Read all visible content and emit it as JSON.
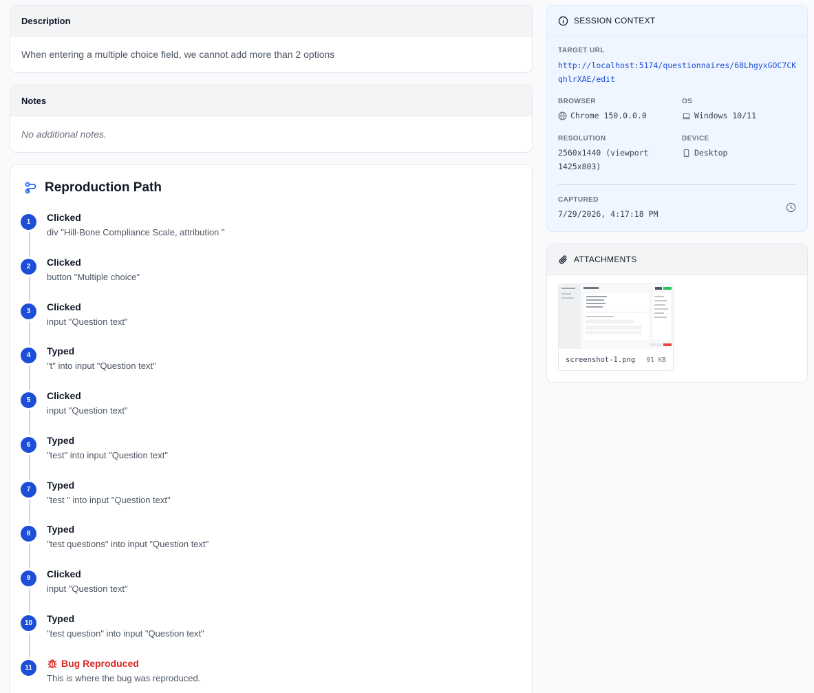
{
  "description": {
    "title": "Description",
    "text": "When entering a multiple choice field, we cannot add more than 2 options"
  },
  "notes": {
    "title": "Notes",
    "text": "No additional notes."
  },
  "repro": {
    "title": "Reproduction Path",
    "steps": [
      {
        "num": "1",
        "action": "Clicked",
        "detail": "div \"Hill-Bone Compliance Scale, attribution \""
      },
      {
        "num": "2",
        "action": "Clicked",
        "detail": "button \"Multiple choice\""
      },
      {
        "num": "3",
        "action": "Clicked",
        "detail": "input \"Question text\""
      },
      {
        "num": "4",
        "action": "Typed",
        "detail": "\"t\" into input \"Question text\""
      },
      {
        "num": "5",
        "action": "Clicked",
        "detail": "input \"Question text\""
      },
      {
        "num": "6",
        "action": "Typed",
        "detail": "\"test\" into input \"Question text\""
      },
      {
        "num": "7",
        "action": "Typed",
        "detail": "\"test \" into input \"Question text\""
      },
      {
        "num": "8",
        "action": "Typed",
        "detail": "\"test questions\" into input \"Question text\""
      },
      {
        "num": "9",
        "action": "Clicked",
        "detail": "input \"Question text\""
      },
      {
        "num": "10",
        "action": "Typed",
        "detail": "\"test question\" into input \"Question text\""
      },
      {
        "num": "11",
        "action": "Bug Reproduced",
        "detail": "This is where the bug was reproduced."
      }
    ]
  },
  "session": {
    "title": "SESSION CONTEXT",
    "target_url_label": "TARGET URL",
    "target_url_line1": "http://localhost:5174/questionnaires/68LhgyxGOC7CK",
    "target_url_line2": "qhlrXAE/edit",
    "browser_label": "BROWSER",
    "browser": "Chrome 150.0.0.0",
    "os_label": "OS",
    "os": "Windows 10/11",
    "resolution_label": "RESOLUTION",
    "resolution_line1": "2560x1440 (viewport",
    "resolution_line2": "1425x803)",
    "device_label": "DEVICE",
    "device": "Desktop",
    "captured_label": "CAPTURED",
    "captured": "7/29/2026, 4:17:18 PM"
  },
  "attachments": {
    "title": "ATTACHMENTS",
    "files": [
      {
        "name": "screenshot-1.png",
        "size": "91 KB"
      }
    ]
  },
  "colors": {
    "accent": "#1d4ed8",
    "bug": "#dc2626",
    "context_bg": "#eff6ff"
  }
}
